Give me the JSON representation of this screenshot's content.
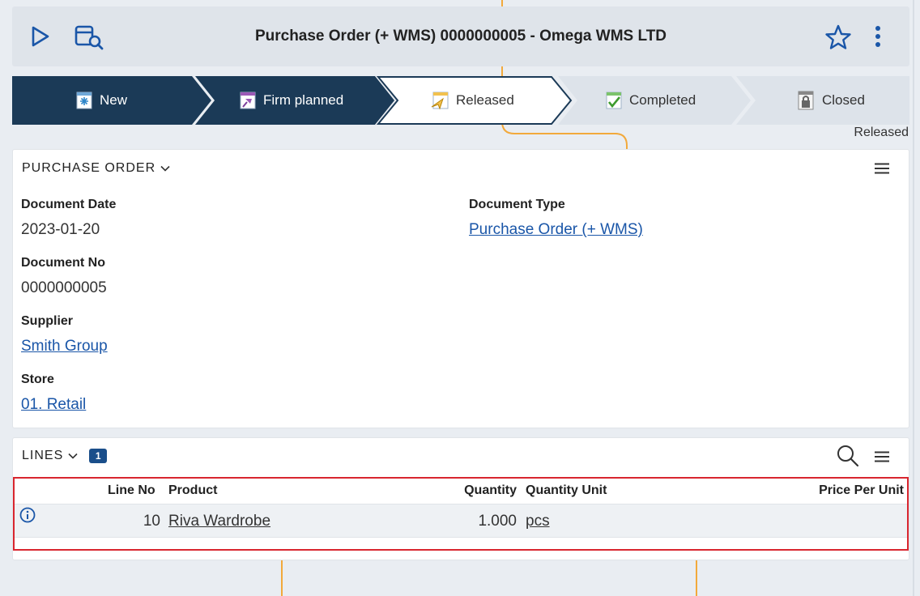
{
  "header": {
    "title": "Purchase Order (+ WMS) 0000000005 - Omega WMS LTD",
    "icons": [
      "play-icon",
      "document-search-icon",
      "star-icon",
      "kebab-menu-icon"
    ]
  },
  "stepper": {
    "steps": [
      {
        "label": "New",
        "icon": "snowflake-icon",
        "state": "done"
      },
      {
        "label": "Firm planned",
        "icon": "pin-icon",
        "state": "done"
      },
      {
        "label": "Released",
        "icon": "paper-plane-icon",
        "state": "current"
      },
      {
        "label": "Completed",
        "icon": "checkmark-icon",
        "state": "todo"
      },
      {
        "label": "Closed",
        "icon": "lock-icon",
        "state": "todo"
      }
    ],
    "status_text": "Released"
  },
  "purchase_order": {
    "section_title": "PURCHASE ORDER",
    "fields": {
      "document_date": {
        "label": "Document Date",
        "value": "2023-01-20"
      },
      "document_no": {
        "label": "Document No",
        "value": "0000000005"
      },
      "supplier": {
        "label": "Supplier",
        "value": "Smith Group"
      },
      "store": {
        "label": "Store",
        "value": "01. Retail"
      },
      "document_type": {
        "label": "Document Type",
        "value": "Purchase Order (+ WMS)"
      }
    }
  },
  "lines": {
    "section_title": "LINES",
    "count": "1",
    "columns": {
      "line_no": "Line No",
      "product": "Product",
      "quantity": "Quantity",
      "quantity_unit": "Quantity Unit",
      "price_per_unit": "Price Per Unit"
    },
    "rows": [
      {
        "line_no": "10",
        "product": "Riva Wardrobe",
        "quantity": "1.000",
        "quantity_unit": "pcs",
        "price_per_unit": ""
      }
    ]
  },
  "colors": {
    "step_done": "#1b3a57",
    "step_todo": "#dde3ea",
    "accent": "#1a56a8",
    "highlight_border": "#d9262f"
  }
}
